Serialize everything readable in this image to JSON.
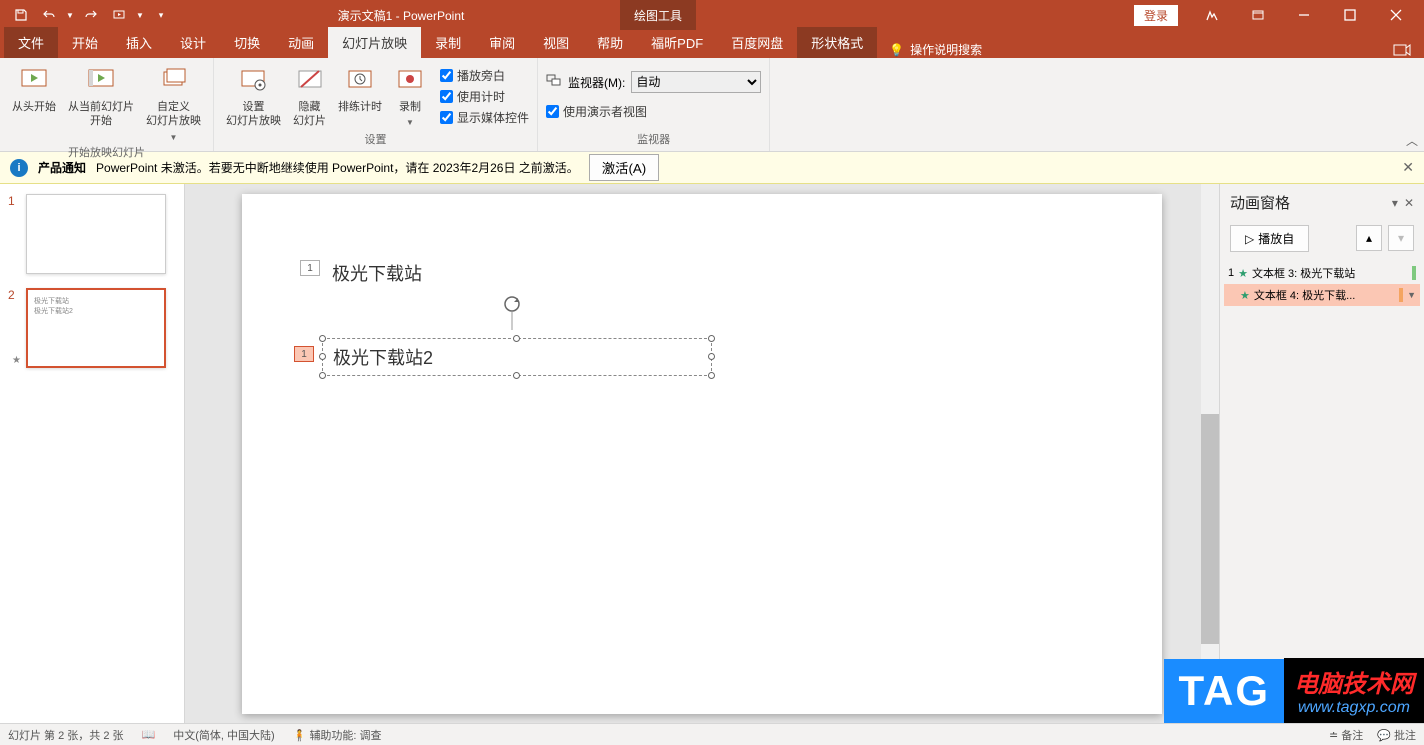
{
  "title": "演示文稿1 - PowerPoint",
  "tools_tab": "绘图工具",
  "login": "登录",
  "tabs": {
    "file": "文件",
    "home": "开始",
    "insert": "插入",
    "design": "设计",
    "transition": "切换",
    "animation": "动画",
    "slideshow": "幻灯片放映",
    "record": "录制",
    "review": "审阅",
    "view": "视图",
    "help": "帮助",
    "foxit": "福昕PDF",
    "baidu": "百度网盘",
    "format": "形状格式",
    "tellme": "操作说明搜索"
  },
  "ribbon": {
    "group1": {
      "from_begin": "从头开始",
      "from_current": "从当前幻灯片\n开始",
      "custom": "自定义\n幻灯片放映",
      "label": "开始放映幻灯片"
    },
    "group2": {
      "setup": "设置\n幻灯片放映",
      "hide": "隐藏\n幻灯片",
      "rehearse": "排练计时",
      "record": "录制",
      "narration": "播放旁白",
      "timing": "使用计时",
      "media": "显示媒体控件",
      "label": "设置"
    },
    "group3": {
      "monitor_label": "监视器(M):",
      "monitor_value": "自动",
      "presenter": "使用演示者视图",
      "label": "监视器"
    }
  },
  "notice": {
    "title": "产品通知",
    "text": "PowerPoint 未激活。若要无中断地继续使用 PowerPoint，请在 2023年2月26日 之前激活。",
    "button": "激活(A)"
  },
  "slides": {
    "s1": "1",
    "s2": "2"
  },
  "canvas": {
    "num1": "1",
    "text1": "极光下载站",
    "num2": "1",
    "text2": "极光下载站2"
  },
  "anim_pane": {
    "title": "动画窗格",
    "play": "播放自",
    "item1_num": "1",
    "item1": "文本框 3: 极光下载站",
    "item2": "文本框 4: 极光下载..."
  },
  "status": {
    "slide": "幻灯片 第 2 张，共 2 张",
    "lang": "中文(简体, 中国大陆)",
    "access": "辅助功能: 调查",
    "notes": "备注",
    "comments": "批注"
  },
  "watermark": {
    "tag": "TAG",
    "line1": "电脑技术网",
    "line2": "www.tagxp.com"
  }
}
